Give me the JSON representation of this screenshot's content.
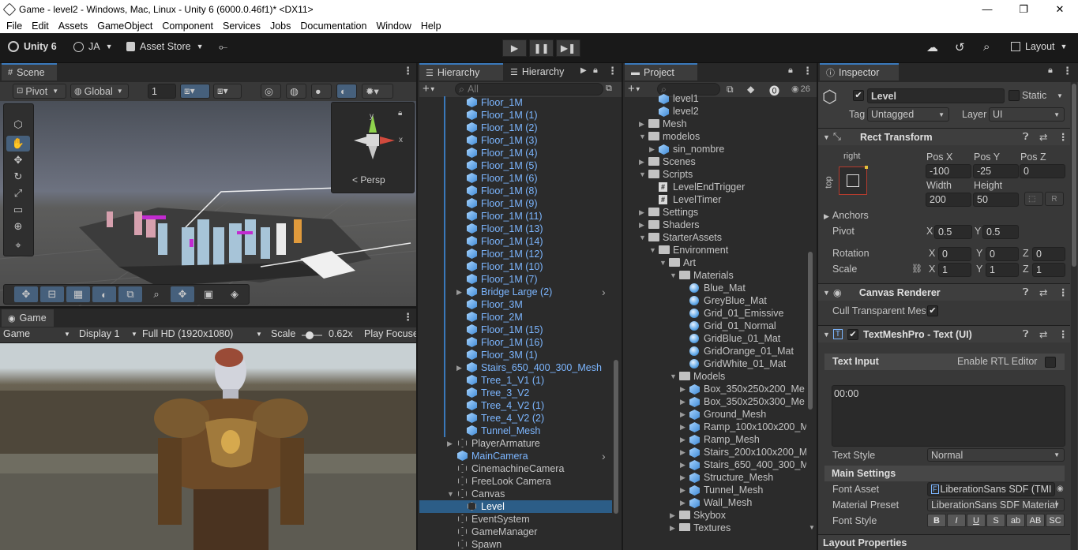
{
  "window": {
    "title": "Game - level2 - Windows, Mac, Linux - Unity 6 (6000.0.46f1)* <DX11>",
    "minimize": "—",
    "maximize": "❐",
    "close": "✕"
  },
  "menu": [
    "File",
    "Edit",
    "Assets",
    "GameObject",
    "Component",
    "Services",
    "Jobs",
    "Documentation",
    "Window",
    "Help"
  ],
  "toolbar": {
    "unity_label": "Unity 6",
    "account": "JA",
    "asset_store": "Asset Store",
    "layout": "Layout"
  },
  "scene": {
    "tab": "Scene",
    "pivot": "Pivot",
    "global": "Global",
    "grid_value": "1",
    "gizmo_label": "< Persp",
    "axis_y": "y",
    "axis_x": "x"
  },
  "game": {
    "tab": "Game",
    "mode": "Game",
    "display": "Display 1",
    "resolution": "Full HD (1920x1080)",
    "scale_label": "Scale",
    "scale_value": "0.62x",
    "play_focus": "Play Focuse"
  },
  "hierarchy": {
    "tab1": "Hierarchy",
    "tab2": "Hierarchy",
    "search_placeholder": "All",
    "items": [
      {
        "label": "Floor_1M",
        "indent": 1,
        "kind": "prefab"
      },
      {
        "label": "Floor_1M (1)",
        "indent": 1,
        "kind": "prefab"
      },
      {
        "label": "Floor_1M (2)",
        "indent": 1,
        "kind": "prefab"
      },
      {
        "label": "Floor_1M (3)",
        "indent": 1,
        "kind": "prefab"
      },
      {
        "label": "Floor_1M (4)",
        "indent": 1,
        "kind": "prefab"
      },
      {
        "label": "Floor_1M (5)",
        "indent": 1,
        "kind": "prefab"
      },
      {
        "label": "Floor_1M (6)",
        "indent": 1,
        "kind": "prefab"
      },
      {
        "label": "Floor_1M (8)",
        "indent": 1,
        "kind": "prefab"
      },
      {
        "label": "Floor_1M (9)",
        "indent": 1,
        "kind": "prefab"
      },
      {
        "label": "Floor_1M (11)",
        "indent": 1,
        "kind": "prefab"
      },
      {
        "label": "Floor_1M (13)",
        "indent": 1,
        "kind": "prefab"
      },
      {
        "label": "Floor_1M (14)",
        "indent": 1,
        "kind": "prefab"
      },
      {
        "label": "Floor_1M (12)",
        "indent": 1,
        "kind": "prefab"
      },
      {
        "label": "Floor_1M (10)",
        "indent": 1,
        "kind": "prefab"
      },
      {
        "label": "Floor_1M (7)",
        "indent": 1,
        "kind": "prefab"
      },
      {
        "label": "Bridge Large (2)",
        "indent": 1,
        "kind": "prefab",
        "arrow": true,
        "right": "›"
      },
      {
        "label": "Floor_3M",
        "indent": 1,
        "kind": "prefab"
      },
      {
        "label": "Floor_2M",
        "indent": 1,
        "kind": "prefab"
      },
      {
        "label": "Floor_1M (15)",
        "indent": 1,
        "kind": "prefab"
      },
      {
        "label": "Floor_1M (16)",
        "indent": 1,
        "kind": "prefab"
      },
      {
        "label": "Floor_3M (1)",
        "indent": 1,
        "kind": "prefab"
      },
      {
        "label": "Stairs_650_400_300_Mesh",
        "indent": 1,
        "kind": "prefab",
        "arrow": true
      },
      {
        "label": "Tree_1_V1 (1)",
        "indent": 1,
        "kind": "prefab"
      },
      {
        "label": "Tree_3_V2",
        "indent": 1,
        "kind": "prefab"
      },
      {
        "label": "Tree_4_V2 (1)",
        "indent": 1,
        "kind": "prefab"
      },
      {
        "label": "Tree_4_V2 (2)",
        "indent": 1,
        "kind": "prefab"
      },
      {
        "label": "Tunnel_Mesh",
        "indent": 1,
        "kind": "prefab"
      },
      {
        "label": "PlayerArmature",
        "indent": 0,
        "kind": "go",
        "arrow": true
      },
      {
        "label": "MainCamera",
        "indent": 0,
        "kind": "prefab",
        "right": "›"
      },
      {
        "label": "CinemachineCamera",
        "indent": 0,
        "kind": "go"
      },
      {
        "label": "FreeLook Camera",
        "indent": 0,
        "kind": "go"
      },
      {
        "label": "Canvas",
        "indent": 0,
        "kind": "go",
        "open": true
      },
      {
        "label": "Level",
        "indent": 1,
        "kind": "go",
        "selected": true
      },
      {
        "label": "EventSystem",
        "indent": 0,
        "kind": "go"
      },
      {
        "label": "GameManager",
        "indent": 0,
        "kind": "go"
      },
      {
        "label": "Spawn",
        "indent": 0,
        "kind": "go"
      }
    ]
  },
  "project": {
    "tab": "Project",
    "count": "26",
    "items": [
      {
        "label": "level1",
        "indent": 2,
        "kind": "scene"
      },
      {
        "label": "level2",
        "indent": 2,
        "kind": "scene"
      },
      {
        "label": "Mesh",
        "indent": 1,
        "kind": "folder",
        "arrow": "closed"
      },
      {
        "label": "modelos",
        "indent": 1,
        "kind": "folder",
        "arrow": "open"
      },
      {
        "label": "sin_nombre",
        "indent": 2,
        "kind": "model",
        "arrow": "closed"
      },
      {
        "label": "Scenes",
        "indent": 1,
        "kind": "folder",
        "arrow": "closed"
      },
      {
        "label": "Scripts",
        "indent": 1,
        "kind": "folder",
        "arrow": "open"
      },
      {
        "label": "LevelEndTrigger",
        "indent": 2,
        "kind": "script"
      },
      {
        "label": "LevelTimer",
        "indent": 2,
        "kind": "script"
      },
      {
        "label": "Settings",
        "indent": 1,
        "kind": "folder",
        "arrow": "closed"
      },
      {
        "label": "Shaders",
        "indent": 1,
        "kind": "folder",
        "arrow": "closed"
      },
      {
        "label": "StarterAssets",
        "indent": 1,
        "kind": "folder",
        "arrow": "open"
      },
      {
        "label": "Environment",
        "indent": 2,
        "kind": "folder",
        "arrow": "open"
      },
      {
        "label": "Art",
        "indent": 3,
        "kind": "folder",
        "arrow": "open"
      },
      {
        "label": "Materials",
        "indent": 4,
        "kind": "folder",
        "arrow": "open"
      },
      {
        "label": "Blue_Mat",
        "indent": 5,
        "kind": "mat"
      },
      {
        "label": "GreyBlue_Mat",
        "indent": 5,
        "kind": "mat"
      },
      {
        "label": "Grid_01_Emissive",
        "indent": 5,
        "kind": "mat"
      },
      {
        "label": "Grid_01_Normal",
        "indent": 5,
        "kind": "mat"
      },
      {
        "label": "GridBlue_01_Mat",
        "indent": 5,
        "kind": "mat"
      },
      {
        "label": "GridOrange_01_Mat",
        "indent": 5,
        "kind": "mat"
      },
      {
        "label": "GridWhite_01_Mat",
        "indent": 5,
        "kind": "mat"
      },
      {
        "label": "Models",
        "indent": 4,
        "kind": "folder",
        "arrow": "open"
      },
      {
        "label": "Box_350x250x200_Me",
        "indent": 5,
        "kind": "model",
        "arrow": "closed"
      },
      {
        "label": "Box_350x250x300_Me",
        "indent": 5,
        "kind": "model",
        "arrow": "closed"
      },
      {
        "label": "Ground_Mesh",
        "indent": 5,
        "kind": "model",
        "arrow": "closed"
      },
      {
        "label": "Ramp_100x100x200_M",
        "indent": 5,
        "kind": "model",
        "arrow": "closed"
      },
      {
        "label": "Ramp_Mesh",
        "indent": 5,
        "kind": "model",
        "arrow": "closed"
      },
      {
        "label": "Stairs_200x100x200_M",
        "indent": 5,
        "kind": "model",
        "arrow": "closed"
      },
      {
        "label": "Stairs_650_400_300_M",
        "indent": 5,
        "kind": "model",
        "arrow": "closed"
      },
      {
        "label": "Structure_Mesh",
        "indent": 5,
        "kind": "model",
        "arrow": "closed"
      },
      {
        "label": "Tunnel_Mesh",
        "indent": 5,
        "kind": "model",
        "arrow": "closed"
      },
      {
        "label": "Wall_Mesh",
        "indent": 5,
        "kind": "model",
        "arrow": "closed"
      },
      {
        "label": "Skybox",
        "indent": 4,
        "kind": "folder",
        "arrow": "closed"
      },
      {
        "label": "Textures",
        "indent": 4,
        "kind": "folder",
        "arrow": "closed"
      }
    ]
  },
  "inspector": {
    "tab": "Inspector",
    "name": "Level",
    "static": "Static",
    "tag_label": "Tag",
    "tag": "Untagged",
    "layer_label": "Layer",
    "layer": "UI",
    "rect": {
      "title": "Rect Transform",
      "anchor_h": "right",
      "anchor_v": "top",
      "posx_label": "Pos X",
      "posy_label": "Pos Y",
      "posz_label": "Pos Z",
      "posx": "-100",
      "posy": "-25",
      "posz": "0",
      "w_label": "Width",
      "h_label": "Height",
      "w": "200",
      "h": "50",
      "r_btn": "R",
      "anchors": "Anchors",
      "pivot": "Pivot",
      "pivot_x": "0.5",
      "pivot_y": "0.5",
      "rotation": "Rotation",
      "rot_x": "0",
      "rot_y": "0",
      "rot_z": "0",
      "scale": "Scale",
      "sc_x": "1",
      "sc_y": "1",
      "sc_z": "1",
      "x": "X",
      "y": "Y",
      "z": "Z"
    },
    "canvas_renderer": {
      "title": "Canvas Renderer",
      "cull": "Cull Transparent Mes"
    },
    "tmp": {
      "title": "TextMeshPro - Text (UI)",
      "text_input": "Text Input",
      "rtl": "Enable RTL Editor",
      "text": "00:00",
      "text_style_label": "Text Style",
      "text_style": "Normal",
      "main_settings": "Main Settings",
      "font_asset_label": "Font Asset",
      "font_asset": "LiberationSans SDF (TMI",
      "material_label": "Material Preset",
      "material": "LiberationSans SDF Material",
      "font_style_label": "Font Style",
      "styles": [
        "B",
        "I",
        "U",
        "S",
        "ab",
        "AB",
        "SC"
      ]
    },
    "layout_props": "Layout Properties"
  }
}
